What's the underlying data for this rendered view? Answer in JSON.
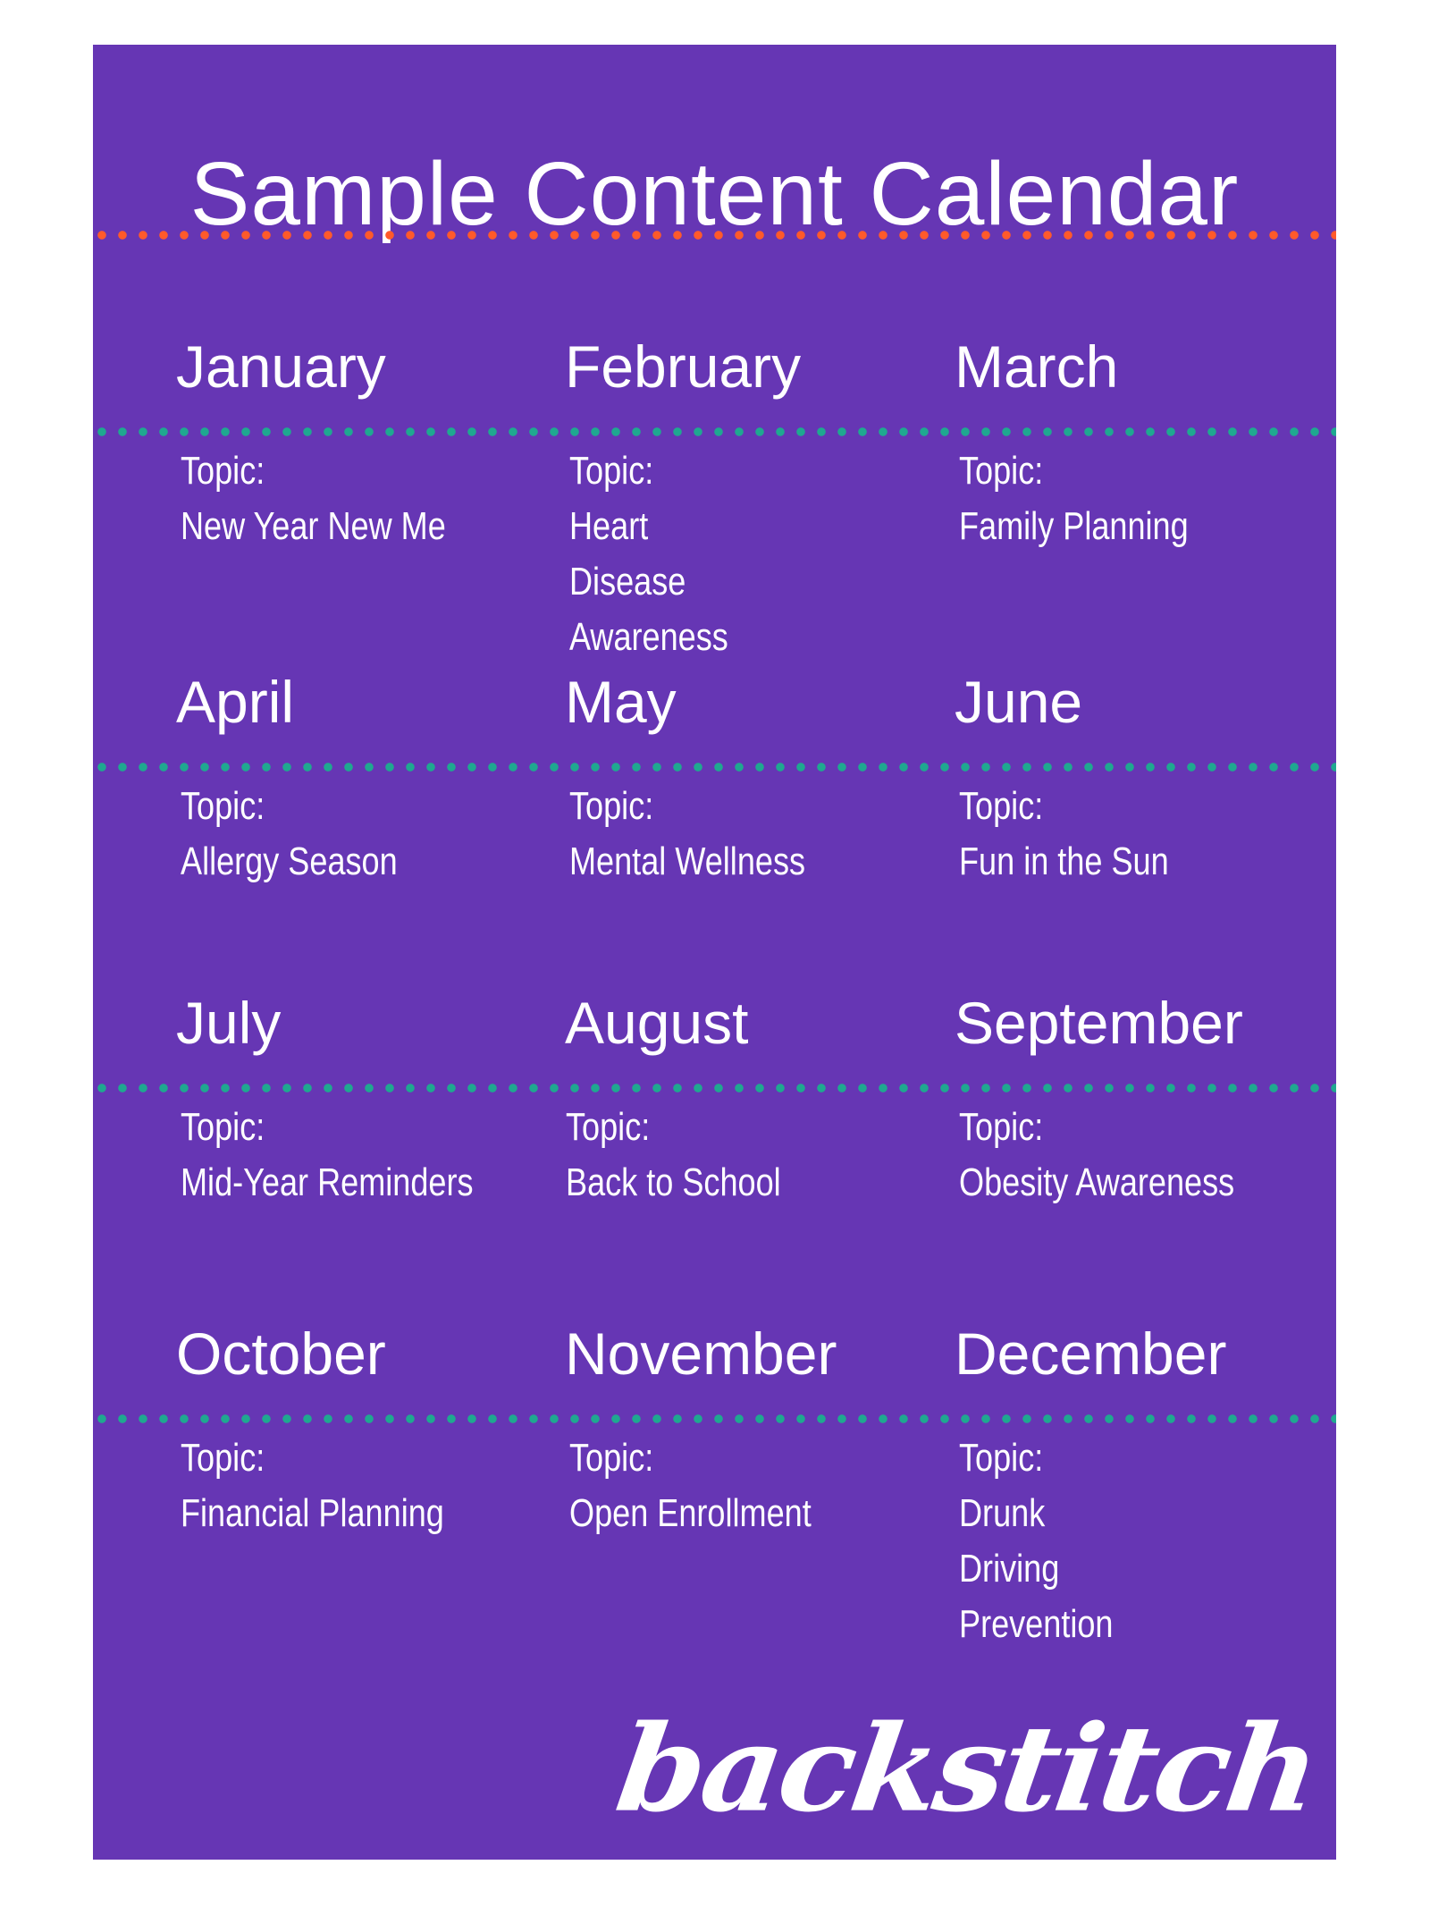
{
  "title": "Sample Content Calendar",
  "colors": {
    "background": "#6636b4",
    "title_divider": "#ff5a2a",
    "row_divider": "#1fa890",
    "text": "#ffffff"
  },
  "topic_label": "Topic:",
  "months": [
    {
      "name": "January",
      "topic": "New Year New Me"
    },
    {
      "name": "February",
      "topic": "Heart Disease Awareness"
    },
    {
      "name": "March",
      "topic": "Family Planning"
    },
    {
      "name": "April",
      "topic": "Allergy Season"
    },
    {
      "name": "May",
      "topic": "Mental Wellness"
    },
    {
      "name": "June",
      "topic": "Fun in the Sun"
    },
    {
      "name": "July",
      "topic": "Mid-Year Reminders"
    },
    {
      "name": "August",
      "topic": "Back to School"
    },
    {
      "name": "September",
      "topic": "Obesity Awareness"
    },
    {
      "name": "October",
      "topic": "Financial Planning"
    },
    {
      "name": "November",
      "topic": "Open Enrollment"
    },
    {
      "name": "December",
      "topic": "Drunk Driving Prevention"
    }
  ],
  "logo": "backstitch"
}
